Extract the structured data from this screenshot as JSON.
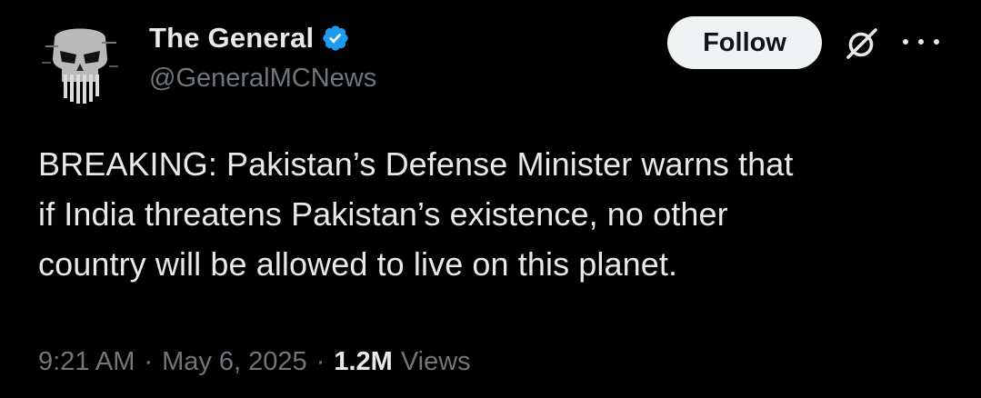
{
  "author": {
    "display_name": "The General",
    "handle": "@GeneralMCNews",
    "verified": true,
    "avatar_icon": "punisher-skull-icon"
  },
  "actions": {
    "follow_label": "Follow",
    "grok_icon": "grok-icon",
    "more_icon": "more-options-icon"
  },
  "tweet": {
    "text_lines": [
      "BREAKING: Pakistan’s Defense Minister warns that",
      "if India threatens Pakistan’s existence, no other",
      "country will be allowed to live on this planet."
    ]
  },
  "meta": {
    "time": "9:21 AM",
    "separator": "·",
    "date": "May 6, 2025",
    "views_count": "1.2M",
    "views_label": "Views"
  },
  "colors": {
    "background": "#000000",
    "primary_text": "#e7e9ea",
    "secondary_text": "#71767b",
    "verified_blue": "#1d9bf0",
    "follow_button_bg": "#eff3f4"
  }
}
